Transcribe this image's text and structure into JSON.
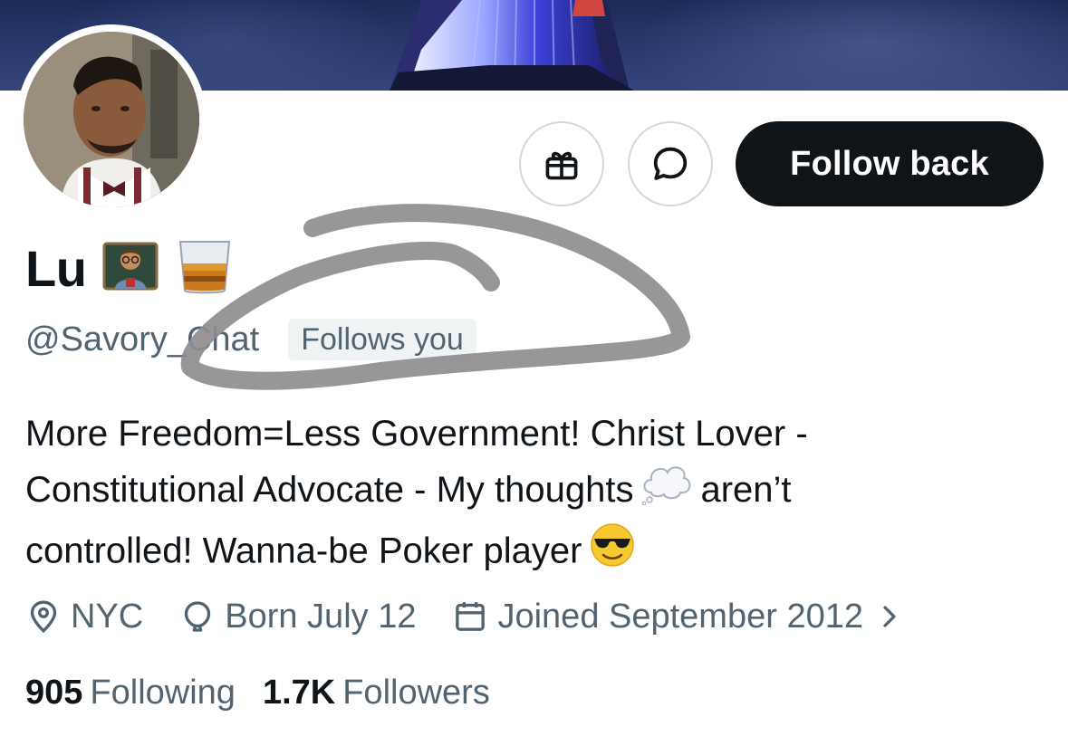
{
  "profile": {
    "name": "Lu",
    "handle": "@Savory_Chat",
    "follows_you_badge": "Follows you",
    "bio_line1": "More Freedom=Less Government! Christ Lover -",
    "bio_line2a": "Constitutional Advocate - My thoughts",
    "bio_line2b": "aren’t",
    "bio_line3": "controlled! Wanna-be Poker player",
    "location": "NYC",
    "birthday": "Born July 12",
    "joined": "Joined September 2012",
    "following_count": "905",
    "following_label": "Following",
    "followers_count": "1.7K",
    "followers_label": "Followers"
  },
  "actions": {
    "follow_back_label": "Follow back",
    "gift_icon": "gift-icon",
    "message_icon": "message-icon"
  },
  "colors": {
    "primary_text": "#0f1419",
    "secondary_text": "#536471",
    "button_dark": "#0f1419",
    "border": "#cfd9de",
    "badge_bg": "#eff3f4",
    "annotation_stroke": "#8f8d8f"
  }
}
